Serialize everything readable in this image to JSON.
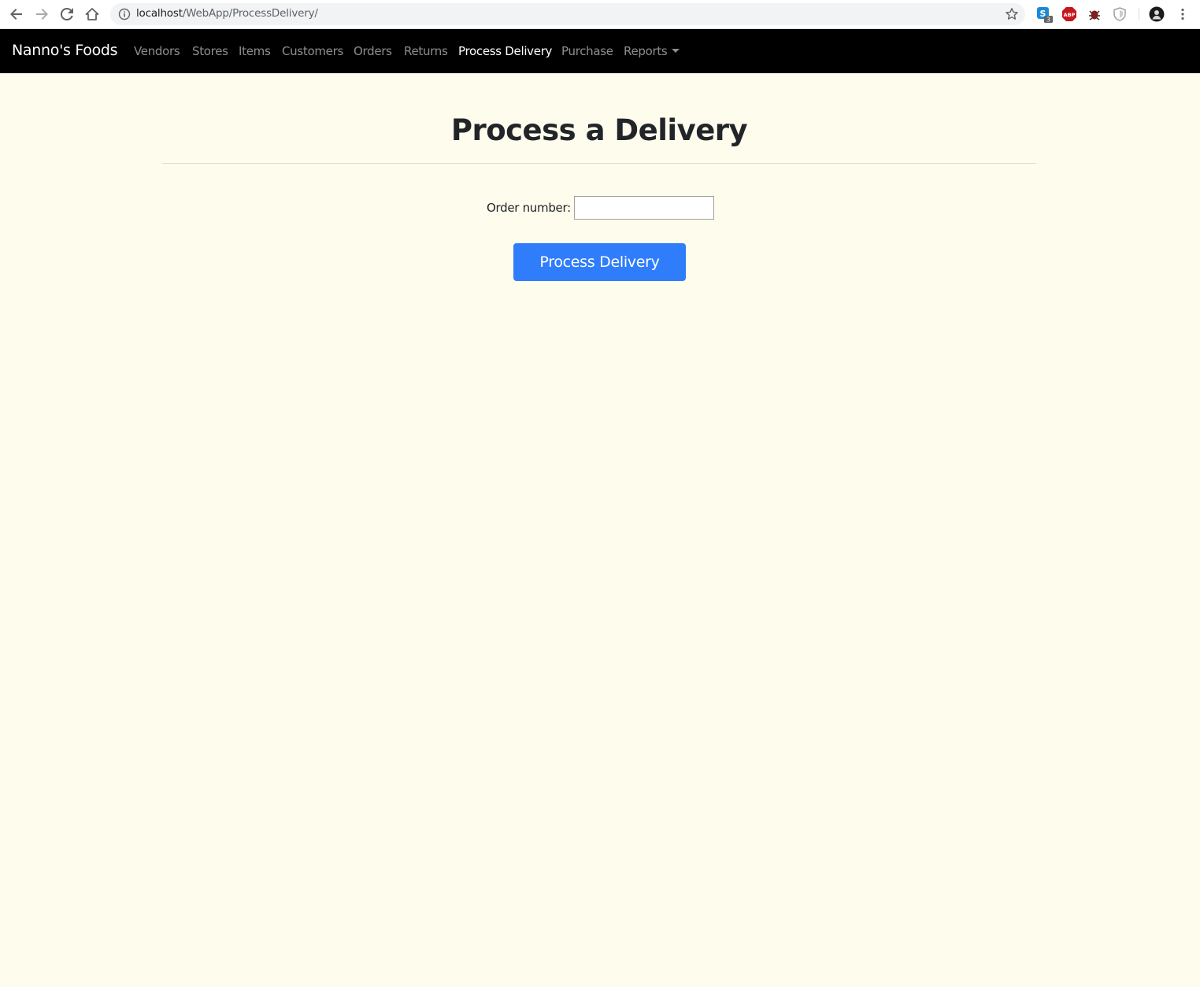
{
  "browser": {
    "url_host": "localhost",
    "url_path": "/WebApp/ProcessDelivery/",
    "extensions": [
      "skype-extension-icon",
      "adblock-icon",
      "bug-extension-icon",
      "shield-extension-icon"
    ],
    "skype_badge": "3"
  },
  "navbar": {
    "brand": "Nanno's Foods",
    "items": [
      {
        "label": "Vendors",
        "active": false
      },
      {
        "label": "Stores",
        "active": false
      },
      {
        "label": "Items",
        "active": false
      },
      {
        "label": "Customers",
        "active": false
      },
      {
        "label": "Orders",
        "active": false
      },
      {
        "label": "Returns",
        "active": false
      },
      {
        "label": "Process Delivery",
        "active": true
      },
      {
        "label": "Purchase",
        "active": false
      },
      {
        "label": "Reports",
        "active": false,
        "dropdown": true
      }
    ]
  },
  "main": {
    "title": "Process a Delivery",
    "order_label": "Order number:",
    "order_value": "",
    "submit_label": "Process Delivery"
  },
  "colors": {
    "page_bg": "#fefcec",
    "navbar_bg": "#000000",
    "primary": "#2f7dfb"
  }
}
